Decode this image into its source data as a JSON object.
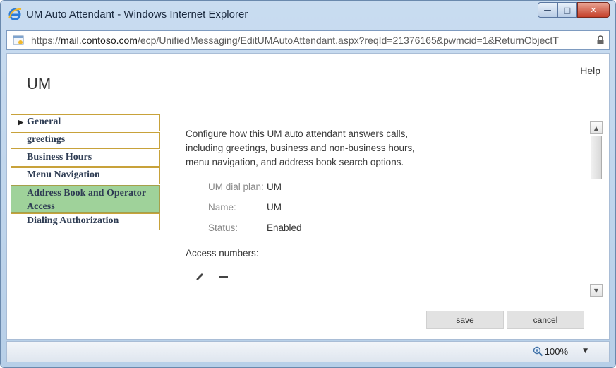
{
  "window": {
    "title": "UM Auto Attendant - Windows Internet Explorer",
    "minimize_glyph": "—",
    "maximize_glyph": "□",
    "close_glyph": "✕"
  },
  "address": {
    "url_prefix": "https://",
    "url_host": "mail.contoso.com",
    "url_path": "/ecp/UnifiedMessaging/EditUMAutoAttendant.aspx?reqId=21376165&pwmcid=1&ReturnObjectT"
  },
  "header": {
    "title": "UM",
    "help": "Help"
  },
  "sidebar": {
    "items": [
      {
        "label": "General",
        "selected_marker": "▶"
      },
      {
        "label": "greetings"
      },
      {
        "label": "Business Hours"
      },
      {
        "label": "Menu Navigation"
      },
      {
        "label": "Address Book and Operator Access"
      },
      {
        "label": "Dialing Authorization"
      }
    ]
  },
  "main": {
    "intro": "Configure how this UM auto attendant answers calls, including greetings, business and non-business hours, menu navigation, and address book search options.",
    "properties": [
      {
        "label": "UM dial plan:",
        "value": "UM"
      },
      {
        "label": "Name:",
        "value": "UM"
      },
      {
        "label": "Status:",
        "value": "Enabled"
      }
    ],
    "access_numbers_label": "Access numbers:",
    "tools": [
      "pencil-icon",
      "minus-icon"
    ]
  },
  "actions": {
    "save": "save",
    "cancel": "cancel"
  },
  "status": {
    "zoom": "100%"
  },
  "colors": {
    "nav_border": "#c8a23a",
    "nav_active_bg": "#9fd29a"
  }
}
